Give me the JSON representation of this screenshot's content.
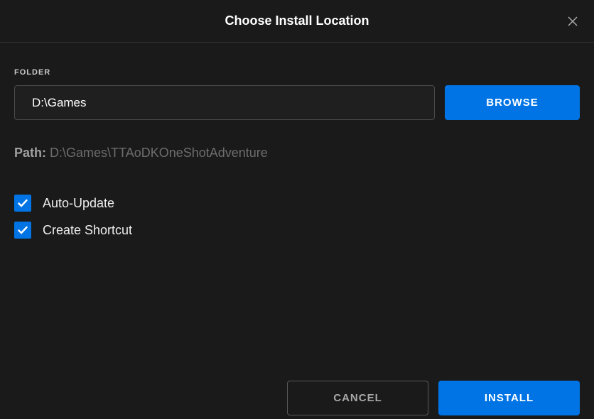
{
  "header": {
    "title": "Choose Install Location"
  },
  "folder": {
    "label": "FOLDER",
    "value": "D:\\Games",
    "browse_label": "BROWSE"
  },
  "path": {
    "label": "Path:",
    "value": "D:\\Games\\TTAoDKOneShotAdventure"
  },
  "options": {
    "auto_update": {
      "label": "Auto-Update",
      "checked": true
    },
    "create_shortcut": {
      "label": "Create Shortcut",
      "checked": true
    }
  },
  "footer": {
    "cancel_label": "CANCEL",
    "install_label": "INSTALL"
  }
}
